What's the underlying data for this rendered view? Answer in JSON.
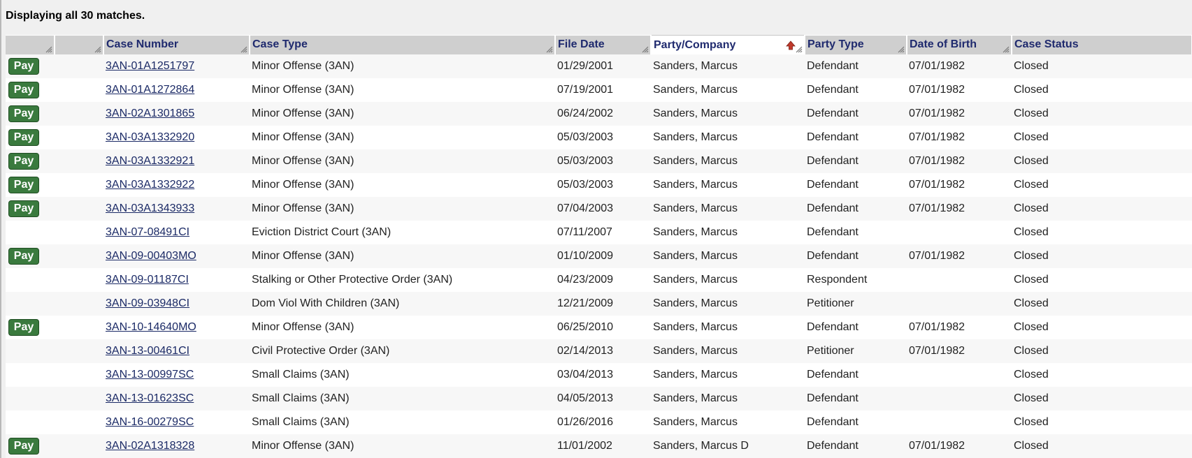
{
  "status": "Displaying all 30 matches.",
  "pay_label": "Pay",
  "columns": [
    "",
    "",
    "Case Number",
    "Case Type",
    "File Date",
    "Party/Company",
    "Party Type",
    "Date of Birth",
    "Case Status"
  ],
  "sorted_column": "Party/Company",
  "rows": [
    {
      "pay": true,
      "case_number": "3AN-01A1251797",
      "case_type": "Minor Offense (3AN)",
      "file_date": "01/29/2001",
      "party": "Sanders, Marcus",
      "party_type": "Defendant",
      "dob": "07/01/1982",
      "status": "Closed"
    },
    {
      "pay": true,
      "case_number": "3AN-01A1272864",
      "case_type": "Minor Offense (3AN)",
      "file_date": "07/19/2001",
      "party": "Sanders, Marcus",
      "party_type": "Defendant",
      "dob": "07/01/1982",
      "status": "Closed"
    },
    {
      "pay": true,
      "case_number": "3AN-02A1301865",
      "case_type": "Minor Offense (3AN)",
      "file_date": "06/24/2002",
      "party": "Sanders, Marcus",
      "party_type": "Defendant",
      "dob": "07/01/1982",
      "status": "Closed"
    },
    {
      "pay": true,
      "case_number": "3AN-03A1332920",
      "case_type": "Minor Offense (3AN)",
      "file_date": "05/03/2003",
      "party": "Sanders, Marcus",
      "party_type": "Defendant",
      "dob": "07/01/1982",
      "status": "Closed"
    },
    {
      "pay": true,
      "case_number": "3AN-03A1332921",
      "case_type": "Minor Offense (3AN)",
      "file_date": "05/03/2003",
      "party": "Sanders, Marcus",
      "party_type": "Defendant",
      "dob": "07/01/1982",
      "status": "Closed"
    },
    {
      "pay": true,
      "case_number": "3AN-03A1332922",
      "case_type": "Minor Offense (3AN)",
      "file_date": "05/03/2003",
      "party": "Sanders, Marcus",
      "party_type": "Defendant",
      "dob": "07/01/1982",
      "status": "Closed"
    },
    {
      "pay": true,
      "case_number": "3AN-03A1343933",
      "case_type": "Minor Offense (3AN)",
      "file_date": "07/04/2003",
      "party": "Sanders, Marcus",
      "party_type": "Defendant",
      "dob": "07/01/1982",
      "status": "Closed"
    },
    {
      "pay": false,
      "case_number": "3AN-07-08491CI",
      "case_type": "Eviction District Court (3AN)",
      "file_date": "07/11/2007",
      "party": "Sanders, Marcus",
      "party_type": "Defendant",
      "dob": "",
      "status": "Closed"
    },
    {
      "pay": true,
      "case_number": "3AN-09-00403MO",
      "case_type": "Minor Offense (3AN)",
      "file_date": "01/10/2009",
      "party": "Sanders, Marcus",
      "party_type": "Defendant",
      "dob": "07/01/1982",
      "status": "Closed"
    },
    {
      "pay": false,
      "case_number": "3AN-09-01187CI",
      "case_type": "Stalking or Other Protective Order (3AN)",
      "file_date": "04/23/2009",
      "party": "Sanders, Marcus",
      "party_type": "Respondent",
      "dob": "",
      "status": "Closed"
    },
    {
      "pay": false,
      "case_number": "3AN-09-03948CI",
      "case_type": "Dom Viol With Children (3AN)",
      "file_date": "12/21/2009",
      "party": "Sanders, Marcus",
      "party_type": "Petitioner",
      "dob": "",
      "status": "Closed"
    },
    {
      "pay": true,
      "case_number": "3AN-10-14640MO",
      "case_type": "Minor Offense (3AN)",
      "file_date": "06/25/2010",
      "party": "Sanders, Marcus",
      "party_type": "Defendant",
      "dob": "07/01/1982",
      "status": "Closed"
    },
    {
      "pay": false,
      "case_number": "3AN-13-00461CI",
      "case_type": "Civil Protective Order (3AN)",
      "file_date": "02/14/2013",
      "party": "Sanders, Marcus",
      "party_type": "Petitioner",
      "dob": "07/01/1982",
      "status": "Closed"
    },
    {
      "pay": false,
      "case_number": "3AN-13-00997SC",
      "case_type": "Small Claims (3AN)",
      "file_date": "03/04/2013",
      "party": "Sanders, Marcus",
      "party_type": "Defendant",
      "dob": "",
      "status": "Closed"
    },
    {
      "pay": false,
      "case_number": "3AN-13-01623SC",
      "case_type": "Small Claims (3AN)",
      "file_date": "04/05/2013",
      "party": "Sanders, Marcus",
      "party_type": "Defendant",
      "dob": "",
      "status": "Closed"
    },
    {
      "pay": false,
      "case_number": "3AN-16-00279SC",
      "case_type": "Small Claims (3AN)",
      "file_date": "01/26/2016",
      "party": "Sanders, Marcus",
      "party_type": "Defendant",
      "dob": "",
      "status": "Closed"
    },
    {
      "pay": true,
      "case_number": "3AN-02A1318328",
      "case_type": "Minor Offense (3AN)",
      "file_date": "11/01/2002",
      "party": "Sanders, Marcus D",
      "party_type": "Defendant",
      "dob": "07/01/1982",
      "status": "Closed"
    }
  ]
}
